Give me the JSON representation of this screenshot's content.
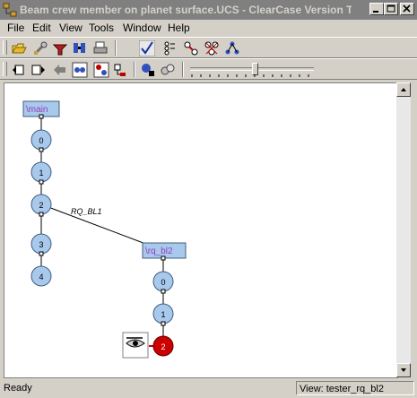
{
  "window": {
    "title": "Beam crew member on planet surface.UCS - ClearCase Version Tre...",
    "buttons": [
      "minimize-icon",
      "maximize-icon",
      "close-icon"
    ]
  },
  "menu": [
    "File",
    "Edit",
    "View",
    "Tools",
    "Window",
    "Help"
  ],
  "toolbar1": {
    "tools": [
      "open-icon",
      "settings-wrench-icon",
      "merge-tool-icon",
      "compare-icon",
      "print-icon",
      "checkmark-icon",
      "list-versions-icon",
      "arrows-icon",
      "branch-node-icon",
      "tree-graph-icon"
    ]
  },
  "toolbar2": {
    "tools": [
      "go-left-icon",
      "go-right-icon",
      "back-arrow-icon",
      "predecessor-icon",
      "successor-icon",
      "label-icon",
      "info-icon",
      "spheres-icon"
    ],
    "zoom_slider_value": 0.53
  },
  "tree": {
    "branches": [
      {
        "label": "\\main",
        "versions": [
          "0",
          "1",
          "2",
          "3",
          "4"
        ]
      },
      {
        "label": "\\rq_bl2",
        "versions": [
          "0",
          "1",
          "2"
        ]
      }
    ],
    "merge_label": "RQ_BL1",
    "checked_out_version": "2",
    "accent_color": "#cc0000",
    "node_color": "#a8c8ec",
    "branch_box_color": "#a8c8ec"
  },
  "status": {
    "left": "Ready",
    "right": "View:  tester_rq_bl2"
  }
}
